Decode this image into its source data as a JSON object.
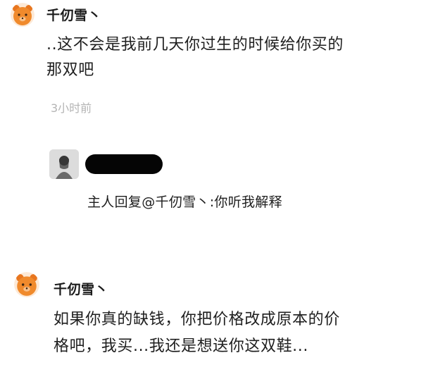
{
  "comment1": {
    "username": "千仞雪丶",
    "text_line1": "..这不会是我前几天你过生的时候给你买的",
    "text_line2": "那双吧",
    "timestamp": "3小时前"
  },
  "reply": {
    "text": "主人回复@千仞雪丶:你听我解释"
  },
  "comment2": {
    "username": "千仞雪丶",
    "text_line1": "如果你真的缺钱，你把价格改成原本的价",
    "text_line2": "格吧，我买...我还是想送你这双鞋..."
  },
  "colors": {
    "avatar_orange": "#f08a2c",
    "timestamp_gray": "#b4b4b4",
    "redaction_black": "#050505"
  },
  "icons": {
    "user_avatar": "orange-bear-avatar",
    "reply_avatar": "person-photo-avatar"
  }
}
